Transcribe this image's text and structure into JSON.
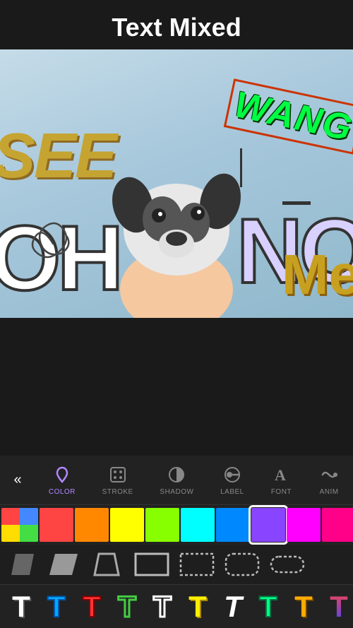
{
  "header": {
    "title": "Text Mixed"
  },
  "canvas": {
    "texts": [
      {
        "id": "see",
        "content": "SEE",
        "style": "italic gold"
      },
      {
        "id": "wang",
        "content": "WANG",
        "style": "green outlined rotated"
      },
      {
        "id": "oh",
        "content": "OH",
        "style": "white outlined large"
      },
      {
        "id": "no",
        "content": "NO",
        "style": "lavender outlined large"
      },
      {
        "id": "me",
        "content": "Me",
        "style": "gold script"
      }
    ]
  },
  "toolbar": {
    "back_icon": "«",
    "tools": [
      {
        "id": "color",
        "label": "COLOR",
        "active": true
      },
      {
        "id": "stroke",
        "label": "STROKE",
        "active": false
      },
      {
        "id": "shadow",
        "label": "SHADOW",
        "active": false
      },
      {
        "id": "label",
        "label": "LABEL",
        "active": false
      },
      {
        "id": "font",
        "label": "FONT",
        "active": false
      },
      {
        "id": "anim",
        "label": "ANIM",
        "active": false
      }
    ]
  },
  "colors": [
    "#ff4444",
    "#ff8800",
    "#ffff00",
    "#88ff00",
    "#00ffff",
    "#0088ff",
    "#8844ff",
    "#ff00ff",
    "#ff0088",
    "#ffffff",
    "#cc2222",
    "#884400",
    "#888800",
    "#224400",
    "#006666",
    "#224488",
    "#442288",
    "#882244",
    "#880044",
    "#888888",
    "#ff9999",
    "#ffcc88",
    "#ffff99",
    "#ccffcc",
    "#ccffff",
    "#9999ff",
    "#cc88ff",
    "#ffccff"
  ],
  "selected_color_index": 6,
  "shapes": [
    {
      "id": "parallelogram-dark",
      "label": "dark parallelogram"
    },
    {
      "id": "parallelogram-gray",
      "label": "gray parallelogram"
    },
    {
      "id": "trapezoid",
      "label": "trapezoid"
    },
    {
      "id": "rectangle-outline",
      "label": "rectangle outline"
    },
    {
      "id": "rectangle-dotted",
      "label": "dotted rectangle"
    },
    {
      "id": "rounded-dotted",
      "label": "dotted rounded"
    },
    {
      "id": "pill",
      "label": "pill shape"
    }
  ],
  "font_colors": [
    {
      "color": "#ffffff",
      "bg": "#333333"
    },
    {
      "color": "#00aaff",
      "bg": "#333333"
    },
    {
      "color": "#ff3333",
      "bg": "#333333"
    },
    {
      "color": "#33ff33",
      "bg": "#333333"
    },
    {
      "color": "#ffffff",
      "bg": "#444444"
    },
    {
      "color": "#ffff00",
      "bg": "#333333"
    },
    {
      "color": "#ffffff",
      "bg": "#444444"
    },
    {
      "color": "#00ff88",
      "bg": "#333333"
    },
    {
      "color": "#ffaa00",
      "bg": "#333333"
    },
    {
      "color": "#ffffff",
      "bg": "#555555"
    }
  ]
}
